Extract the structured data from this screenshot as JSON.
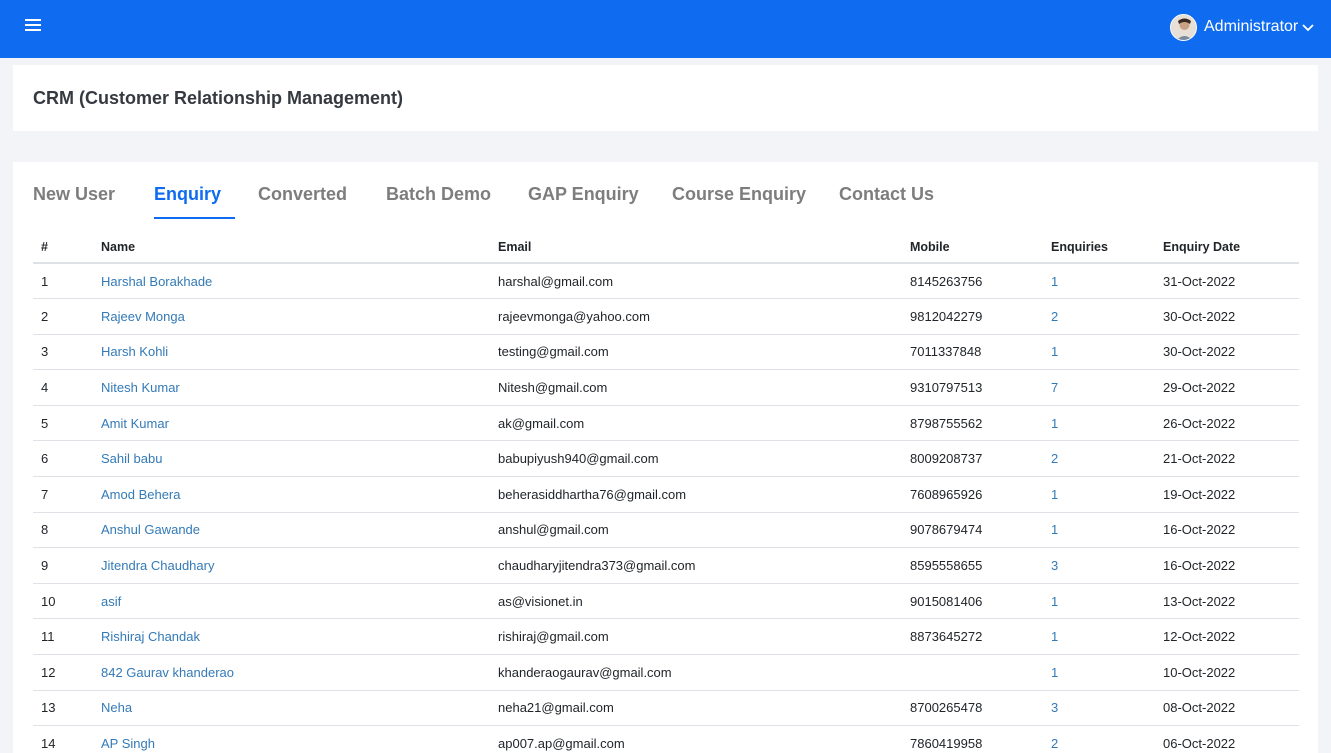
{
  "header": {
    "user_name": "Administrator",
    "accent": "#0f6cf0"
  },
  "page": {
    "title": "CRM (Customer Relationship Management)"
  },
  "tabs": [
    {
      "label": "New User",
      "active": false
    },
    {
      "label": "Enquiry",
      "active": true
    },
    {
      "label": "Converted",
      "active": false
    },
    {
      "label": "Batch Demo",
      "active": false
    },
    {
      "label": "GAP Enquiry",
      "active": false
    },
    {
      "label": "Course Enquiry",
      "active": false
    },
    {
      "label": "Contact Us",
      "active": false
    }
  ],
  "table": {
    "columns": [
      "#",
      "Name",
      "Email",
      "Mobile",
      "Enquiries",
      "Enquiry Date"
    ],
    "rows": [
      {
        "num": "1",
        "name": "Harshal Borakhade",
        "email": "harshal@gmail.com",
        "mobile": "8145263756",
        "enquiries": "1",
        "date": "31-Oct-2022"
      },
      {
        "num": "2",
        "name": "Rajeev Monga",
        "email": "rajeevmonga@yahoo.com",
        "mobile": "9812042279",
        "enquiries": "2",
        "date": "30-Oct-2022"
      },
      {
        "num": "3",
        "name": "Harsh Kohli",
        "email": "testing@gmail.com",
        "mobile": "7011337848",
        "enquiries": "1",
        "date": "30-Oct-2022"
      },
      {
        "num": "4",
        "name": "Nitesh Kumar",
        "email": "Nitesh@gmail.com",
        "mobile": "9310797513",
        "enquiries": "7",
        "date": "29-Oct-2022"
      },
      {
        "num": "5",
        "name": "Amit Kumar",
        "email": "ak@gmail.com",
        "mobile": "8798755562",
        "enquiries": "1",
        "date": "26-Oct-2022"
      },
      {
        "num": "6",
        "name": "Sahil babu",
        "email": "babupiyush940@gmail.com",
        "mobile": "8009208737",
        "enquiries": "2",
        "date": "21-Oct-2022"
      },
      {
        "num": "7",
        "name": "Amod Behera",
        "email": "beherasiddhartha76@gmail.com",
        "mobile": "7608965926",
        "enquiries": "1",
        "date": "19-Oct-2022"
      },
      {
        "num": "8",
        "name": "Anshul Gawande",
        "email": "anshul@gmail.com",
        "mobile": "9078679474",
        "enquiries": "1",
        "date": "16-Oct-2022"
      },
      {
        "num": "9",
        "name": "Jitendra Chaudhary",
        "email": "chaudharyjitendra373@gmail.com",
        "mobile": "8595558655",
        "enquiries": "3",
        "date": "16-Oct-2022"
      },
      {
        "num": "10",
        "name": "asif",
        "email": "as@visionet.in",
        "mobile": "9015081406",
        "enquiries": "1",
        "date": "13-Oct-2022"
      },
      {
        "num": "11",
        "name": "Rishiraj Chandak",
        "email": "rishiraj@gmail.com",
        "mobile": "8873645272",
        "enquiries": "1",
        "date": "12-Oct-2022"
      },
      {
        "num": "12",
        "name": "842 Gaurav khanderao",
        "email": "khanderaogaurav@gmail.com",
        "mobile": "",
        "enquiries": "1",
        "date": "10-Oct-2022"
      },
      {
        "num": "13",
        "name": "Neha",
        "email": "neha21@gmail.com",
        "mobile": "8700265478",
        "enquiries": "3",
        "date": "08-Oct-2022"
      },
      {
        "num": "14",
        "name": "AP Singh",
        "email": "ap007.ap@gmail.com",
        "mobile": "7860419958",
        "enquiries": "2",
        "date": "06-Oct-2022"
      }
    ]
  }
}
